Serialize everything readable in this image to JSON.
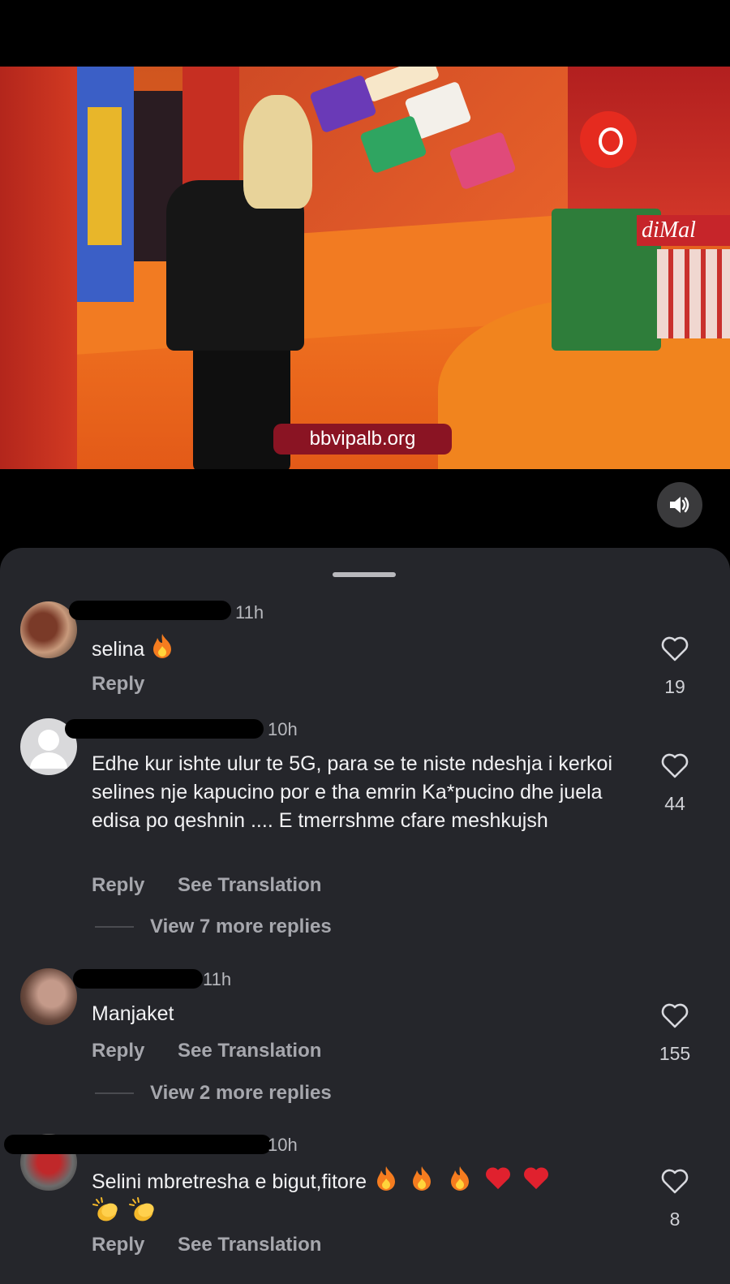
{
  "video": {
    "watermark": "bbvipalb.org",
    "store_sign": "diMal",
    "sound_icon": "speaker-on-icon"
  },
  "comments": [
    {
      "time": "11h",
      "text": "selina",
      "emojis": [
        "fire"
      ],
      "reply_label": "Reply",
      "likes": "19"
    },
    {
      "time": "10h",
      "text": "Edhe kur ishte ulur te 5G, para se te niste ndeshja i kerkoi selines nje kapucino por e tha emrin Ka*pucino dhe juela edisa po qeshnin .... E tmerrshme cfare meshkujsh",
      "reply_label": "Reply",
      "translate_label": "See Translation",
      "view_replies": "View 7 more replies",
      "likes": "44"
    },
    {
      "time": "11h",
      "text": "Manjaket",
      "reply_label": "Reply",
      "translate_label": "See Translation",
      "view_replies": "View 2 more replies",
      "likes": "155"
    },
    {
      "time": "10h",
      "text": "Selini mbretresha e bigut,fitore",
      "emojis": [
        "fire",
        "fire",
        "fire",
        "red-heart",
        "red-heart",
        "clapping-hands",
        "clapping-hands"
      ],
      "reply_label": "Reply",
      "translate_label": "See Translation",
      "likes": "8"
    }
  ]
}
